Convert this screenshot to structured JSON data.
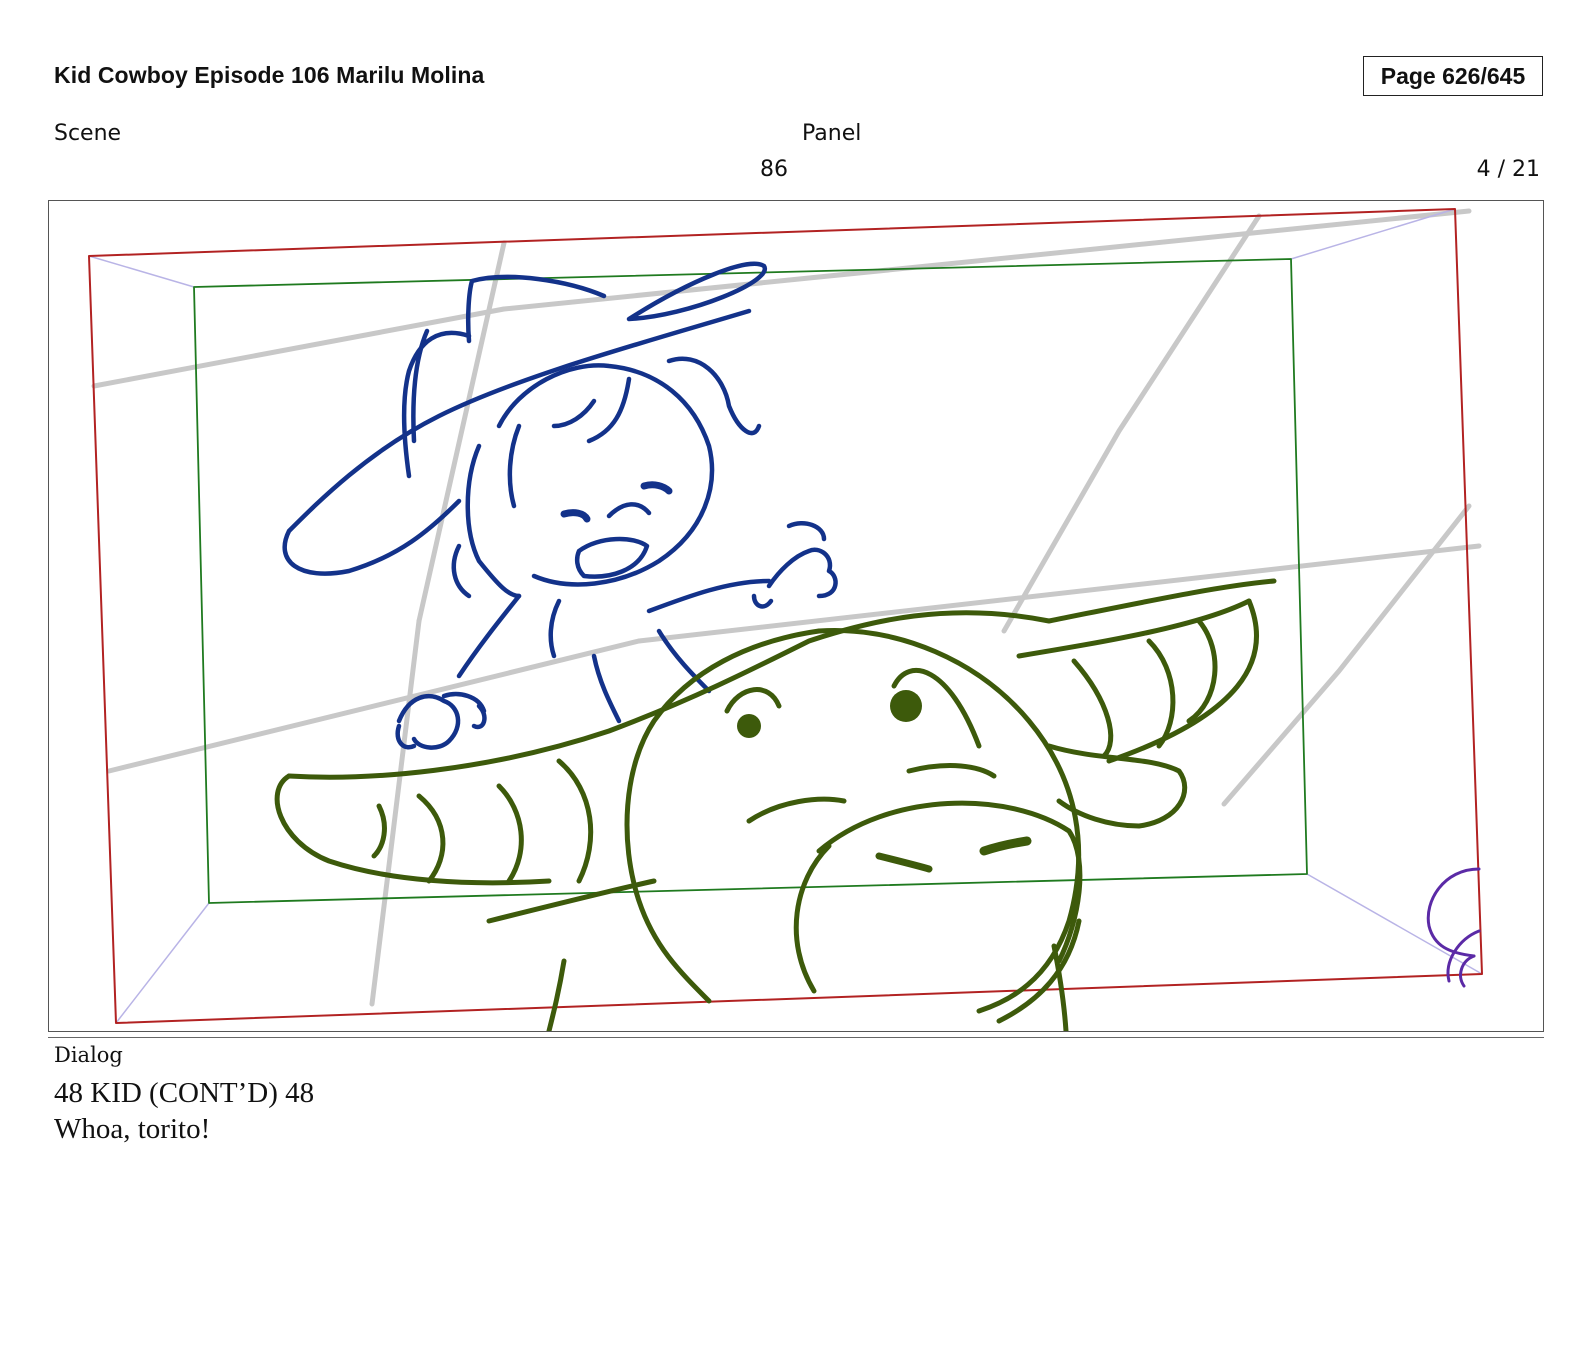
{
  "header": {
    "title": "Kid Cowboy Episode 106 Marilu Molina",
    "page": "Page 626/645"
  },
  "meta": {
    "scene_label": "Scene",
    "panel_label": "Panel",
    "scene_value": "86",
    "panel_value": "4 / 21"
  },
  "panel_image": {
    "description_icons": [
      "kid-cowboy-sketch",
      "bull-calf-sketch",
      "camera-frame-guides"
    ],
    "colors": {
      "safe_frame": "#1f7a1f",
      "camera_frame": "#b22222",
      "kid_stroke": "#13328a",
      "bull_stroke": "#3d5a0b",
      "perspective_lines": "#c8c8c8",
      "corner_guides": "#b9b4e6",
      "offscreen_character": "#5b2aa6"
    }
  },
  "dialog": {
    "label": "Dialog",
    "lines": [
      "48 KID (CONT’D) 48",
      "Whoa, torito!"
    ]
  }
}
